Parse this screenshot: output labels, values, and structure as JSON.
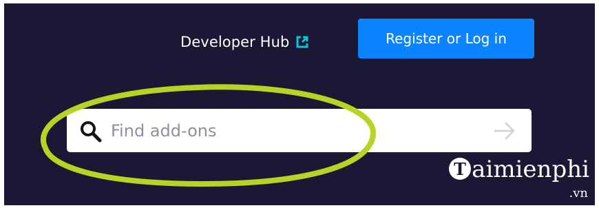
{
  "header": {
    "developer_hub_label": "Developer Hub",
    "register_label": "Register or Log in"
  },
  "search": {
    "placeholder": "Find add-ons",
    "value": ""
  },
  "watermark": {
    "main": "aimienphi",
    "logo_letter": "T",
    "suffix": ".vn"
  },
  "colors": {
    "background": "#1b1735",
    "button": "#0a84ff",
    "external_link_icon": "#00c8d7",
    "annotation": "#b5d522"
  },
  "icons": {
    "external_link": "external-link-icon",
    "search": "search-icon",
    "submit": "arrow-right-icon"
  }
}
